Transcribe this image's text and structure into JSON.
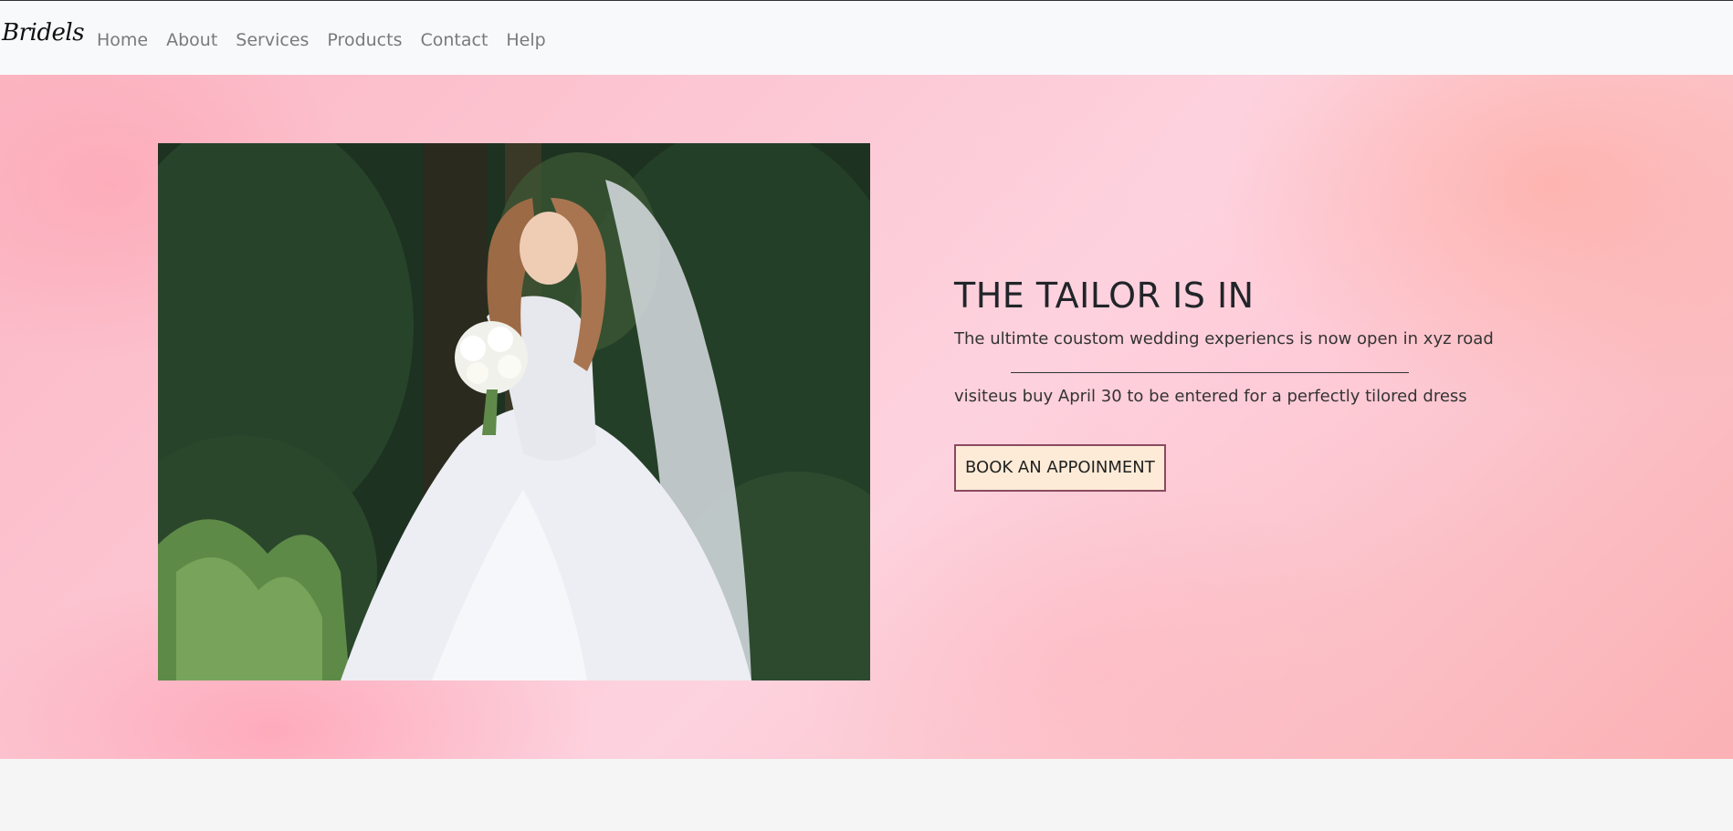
{
  "navbar": {
    "brand": "Bridels",
    "items": [
      {
        "label": "Home"
      },
      {
        "label": "About"
      },
      {
        "label": "Services"
      },
      {
        "label": "Products"
      },
      {
        "label": "Contact"
      },
      {
        "label": "Help"
      }
    ]
  },
  "hero": {
    "title": "THE TAILOR IS IN",
    "text_1": "The ultimte coustom wedding experiencs is now open in xyz road",
    "text_2": "visiteus buy April 30 to be entered for a perfectly tilored dress",
    "button_label": "BOOK AN APPOINMENT",
    "colors": {
      "background": "#fcc6d2",
      "button_bg": "#fdebd7",
      "button_border": "#8a4a5e"
    }
  }
}
